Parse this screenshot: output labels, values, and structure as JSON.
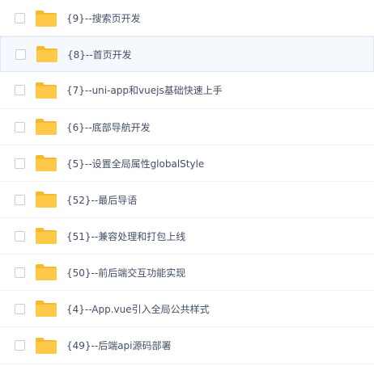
{
  "files": [
    {
      "name": "{9}--搜索页开发"
    },
    {
      "name": "{8}--首页开发"
    },
    {
      "name": "{7}--uni-app和vuejs基础快速上手"
    },
    {
      "name": "{6}--底部导航开发"
    },
    {
      "name": "{5}--设置全局属性globalStyle"
    },
    {
      "name": "{52}--最后导语"
    },
    {
      "name": "{51}--兼容处理和打包上线"
    },
    {
      "name": "{50}--前后端交互功能实现"
    },
    {
      "name": "{4}--App.vue引入全局公共样式"
    },
    {
      "name": "{49}--后端api源码部署"
    }
  ],
  "icons": {
    "row_icon": "folder-icon",
    "select": "checkbox"
  },
  "colors": {
    "folder_body": "#ffc94a",
    "folder_tab": "#f7b92c",
    "text": "#424e67",
    "highlight_bg": "#f5f8fc"
  }
}
